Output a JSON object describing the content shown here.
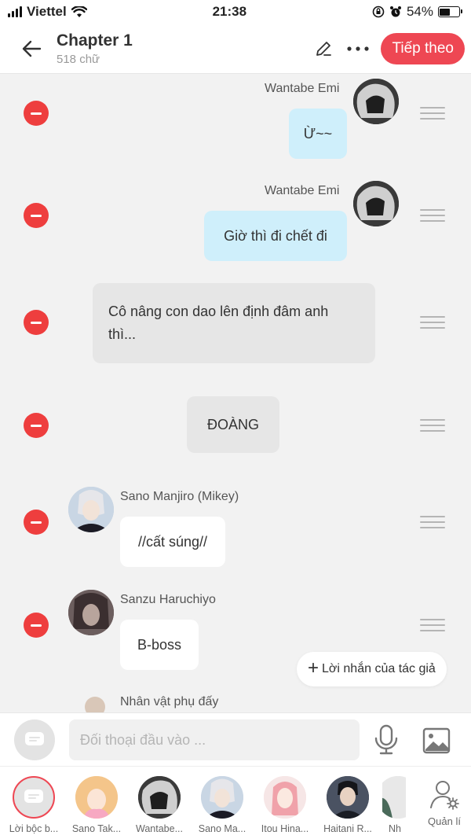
{
  "status_bar": {
    "carrier": "Viettel",
    "time": "21:38",
    "battery": "54%",
    "battery_level": 0.54
  },
  "header": {
    "title": "Chapter 1",
    "word_count": "518 chữ",
    "next_button": "Tiếp theo"
  },
  "messages": [
    {
      "speaker": "Wantabe Emi",
      "text": "Ừ~~",
      "side": "right"
    },
    {
      "speaker": "Wantabe Emi",
      "text": "Giờ thì đi chết đi",
      "side": "right"
    },
    {
      "speaker": "",
      "text": "Cô nâng con dao lên định đâm anh thì...",
      "side": "narration"
    },
    {
      "speaker": "",
      "text": "ĐOÀNG",
      "side": "sound"
    },
    {
      "speaker": "Sano Manjiro (Mikey)",
      "text": "//cất súng//",
      "side": "left"
    },
    {
      "speaker": "Sanzu Haruchiyo",
      "text": "B-boss",
      "side": "left"
    },
    {
      "speaker": "Nhân vật phụ đấy",
      "text": "",
      "side": "left"
    }
  ],
  "author_note": "Lời nhắn của tác giả",
  "composer": {
    "placeholder": "Đối thoại đầu vào ..."
  },
  "characters": [
    {
      "label": "Lời bộc b..."
    },
    {
      "label": "Sano Tak..."
    },
    {
      "label": "Wantabe..."
    },
    {
      "label": "Sano Ma..."
    },
    {
      "label": "Itou Hina..."
    },
    {
      "label": "Haitani R..."
    },
    {
      "label": "Nh"
    }
  ],
  "manage_label": "Quản lí",
  "colors": {
    "accent": "#ee4753",
    "delete": "#ee3e3e",
    "bubble_blue": "#cfeffb",
    "bubble_grey": "#e6e6e6"
  }
}
